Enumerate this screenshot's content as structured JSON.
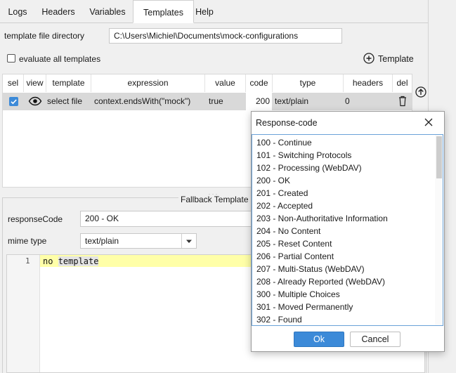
{
  "tabs": [
    "Logs",
    "Headers",
    "Variables",
    "Templates",
    "Help"
  ],
  "active_tab": "Templates",
  "template_dir": {
    "label": "template file directory",
    "value": "C:\\Users\\Michiel\\Documents\\mock-configurations"
  },
  "evaluate_all": {
    "label": "evaluate all templates",
    "checked": false
  },
  "add_template_label": "Template",
  "table": {
    "headers": [
      "sel",
      "view",
      "template",
      "expression",
      "value",
      "code",
      "type",
      "headers",
      "del"
    ],
    "row": {
      "template": "select file",
      "expression": "context.endsWith(\"mock\")",
      "value": "true",
      "code": "200",
      "type": "text/plain",
      "headers": "0"
    }
  },
  "fallback": {
    "title": "Fallback Template",
    "response_code_label": "responseCode",
    "response_code_value": "200 - OK",
    "mime_label": "mime type",
    "mime_value": "text/plain",
    "editor_line_number": "1",
    "editor_text_a": "no ",
    "editor_text_b": "template"
  },
  "dialog": {
    "title": "Response-code",
    "items": [
      "100 - Continue",
      "101 - Switching Protocols",
      "102 - Processing (WebDAV)",
      "200 - OK",
      "201 - Created",
      "202 - Accepted",
      "203 - Non-Authoritative Information",
      "204 - No Content",
      "205 - Reset Content",
      "206 - Partial Content",
      "207 - Multi-Status (WebDAV)",
      "208 - Already Reported (WebDAV)",
      "300 - Multiple Choices",
      "301 - Moved Permanently",
      "302 - Found"
    ],
    "ok_label": "Ok",
    "cancel_label": "Cancel"
  },
  "colors": {
    "accent": "#3c8ad8",
    "highlight_line": "#ffffa8",
    "selected_row": "#d9d9d9"
  }
}
